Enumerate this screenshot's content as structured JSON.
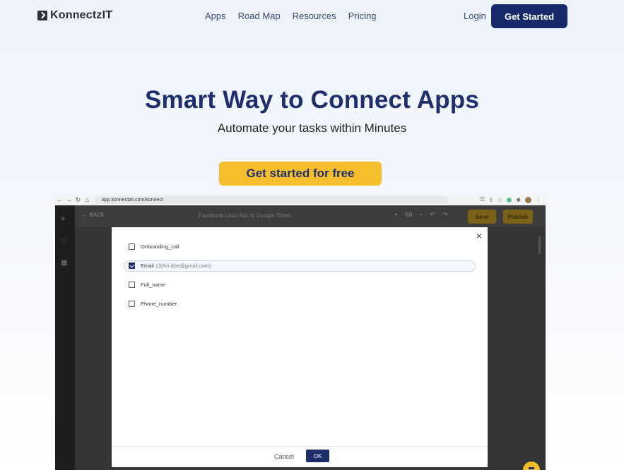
{
  "brand": {
    "name": "KonnectzIT"
  },
  "nav": {
    "links": [
      "Apps",
      "Road Map",
      "Resources",
      "Pricing"
    ],
    "login": "Login",
    "cta": "Get Started"
  },
  "hero": {
    "title": "Smart Way to Connect Apps",
    "subtitle": "Automate your tasks within Minutes",
    "cta": "Get started for free"
  },
  "mockup": {
    "url": "app.konnectzit.com/konnect",
    "back_label": "BACK",
    "flow_title": "Facebook Lead Ads to Google Sheet",
    "zoom": "69",
    "save_label": "Save",
    "publish_label": "Publish",
    "modal": {
      "close": "×",
      "options": [
        {
          "label": "Onboarding_call",
          "hint": "",
          "checked": false
        },
        {
          "label": "Email",
          "hint": "(John.doe@gmail.com)",
          "checked": true
        },
        {
          "label": "Full_name",
          "hint": "",
          "checked": false
        },
        {
          "label": "Phone_number",
          "hint": "",
          "checked": false
        }
      ],
      "cancel_label": "Cancel",
      "ok_label": "OK"
    }
  },
  "colors": {
    "primary": "#1f2f6d",
    "accent": "#f6bd2c"
  }
}
